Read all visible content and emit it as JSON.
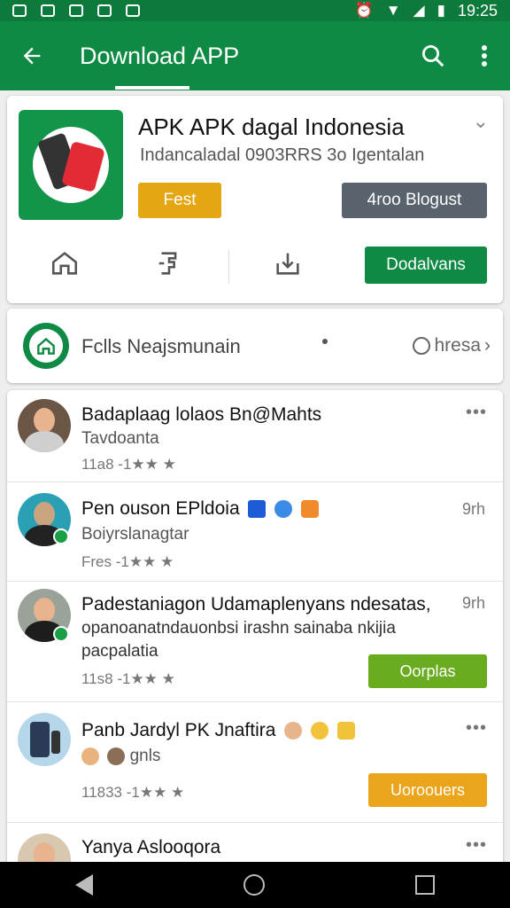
{
  "status_bar": {
    "time": "19:25"
  },
  "app_bar": {
    "title": "Download APP"
  },
  "app_card": {
    "title": "APK APK dagal Indonesia",
    "subtitle": "Indancaladal 0903RRS 3o Igentalan",
    "yellow_button": "Fest",
    "grey_button": "4roo Blogust",
    "green_button": "Dodalvans"
  },
  "strip": {
    "label": "Fclls Neajsmunain",
    "right_label": "hresa"
  },
  "feed": [
    {
      "name": "Badaplaag lolaos Bn@Mahts",
      "line": "Tavdoanta",
      "meta": "11a8 -1★★ ★"
    },
    {
      "name": "Pen ouson EPldoia",
      "time": "9rh",
      "line": "Boiyrslanagtar",
      "meta": "Fres -1★★ ★"
    },
    {
      "name": "Padestaniagon Udamaplenyans ndesatas,",
      "time": "9rh",
      "line": "opanoanatndauonbsi irashn sainaba nkijia",
      "line2": "pacpalatia",
      "meta": "11s8 -1★★ ★",
      "button": "Oorplas"
    },
    {
      "name": "Panb Jardyl PK Jnaftira",
      "line": "gnls",
      "meta": "11833 -1★★ ★",
      "button": "Uoroouers"
    },
    {
      "name": "Yanya Aslooqora"
    }
  ]
}
